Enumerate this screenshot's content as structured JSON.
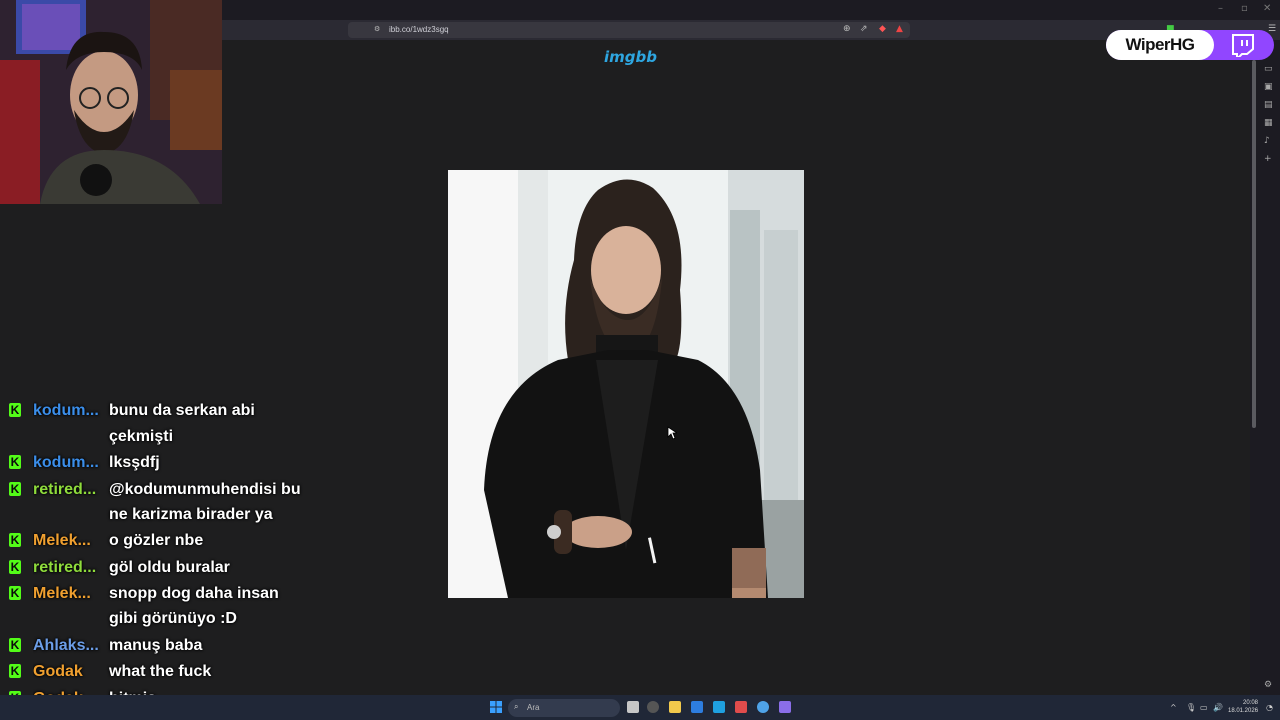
{
  "browser": {
    "url": "ibb.co/1wdz3sgq",
    "window_controls": [
      "–",
      "▫",
      "✕"
    ]
  },
  "site": {
    "logo": "imgbb",
    "photo_alt": "Man with long hair and beard in black coat holding a cigarette"
  },
  "overlay": {
    "channel_name": "WiperHG",
    "platform_icon": "twitch-icon"
  },
  "chat": {
    "partial_top": {
      "user": "kodum...",
      "text": "bunu da serkan abi",
      "continuation": "çekmişti"
    },
    "messages": [
      {
        "user": "kodum...",
        "color": "#3b8eea",
        "lines": [
          "lksşdfj"
        ]
      },
      {
        "user": "retired...",
        "color": "#8fdc3c",
        "lines": [
          "@kodumunmuhendisi bu",
          "ne karizma birader ya"
        ]
      },
      {
        "user": "Melek...",
        "color": "#f0a030",
        "lines": [
          "o gözler nbe"
        ]
      },
      {
        "user": "retired...",
        "color": "#8fdc3c",
        "lines": [
          "göl oldu buralar"
        ]
      },
      {
        "user": "Melek...",
        "color": "#f0a030",
        "lines": [
          "snopp dog daha insan",
          "gibi görünüyo :D"
        ]
      },
      {
        "user": "Ahlaks...",
        "color": "#6c9ee8",
        "lines": [
          "manuş baba"
        ]
      },
      {
        "user": "Godak",
        "color": "#f0a030",
        "lines": [
          "what the fuck"
        ]
      },
      {
        "user": "Godak",
        "color": "#f0a030",
        "lines": [
          "bitmiş"
        ]
      }
    ]
  },
  "taskbar": {
    "search_placeholder": "Ara",
    "time": "20:08",
    "date": "18.01.2026"
  }
}
